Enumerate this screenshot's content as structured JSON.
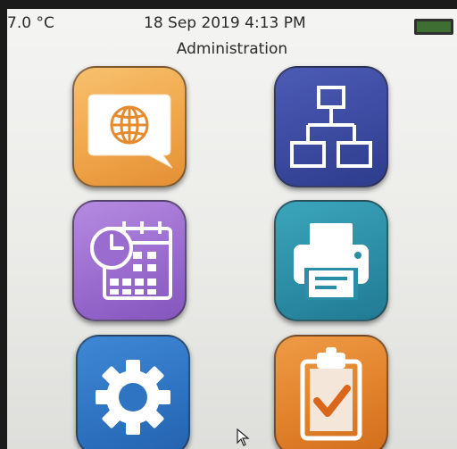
{
  "status_bar": {
    "temperature": "7.0 °C",
    "datetime": "18 Sep 2019 4:13 PM",
    "battery_icon": "battery-icon"
  },
  "page": {
    "title": "Administration"
  },
  "tiles": [
    {
      "icon": "globe-chat-icon",
      "color": "#f0a64a"
    },
    {
      "icon": "network-icon",
      "color": "#3c4aa0"
    },
    {
      "icon": "calendar-clock-icon",
      "color": "#9a6ccf"
    },
    {
      "icon": "printer-icon",
      "color": "#2c8ea6"
    },
    {
      "icon": "gear-icon",
      "color": "#2f74c2"
    },
    {
      "icon": "clipboard-check-icon",
      "color": "#e2822b"
    }
  ],
  "cursor_icon": "mouse-pointer-icon"
}
